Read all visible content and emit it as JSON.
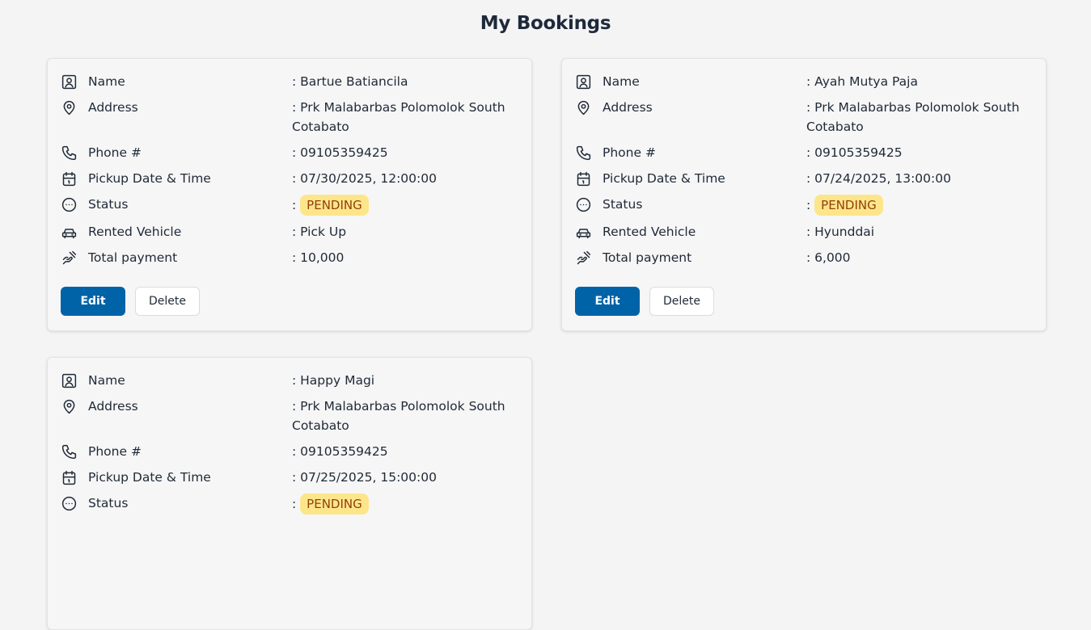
{
  "page_title": "My Bookings",
  "labels": {
    "name": "Name",
    "address": "Address",
    "phone": "Phone #",
    "pickup": "Pickup Date & Time",
    "status": "Status",
    "vehicle": "Rented Vehicle",
    "payment": "Total payment"
  },
  "buttons": {
    "edit": "Edit",
    "delete": "Delete"
  },
  "colors": {
    "primary": "#0063a8",
    "badge_bg": "#fde68a",
    "badge_text": "#92400e"
  },
  "bookings": [
    {
      "name": ": Bartue Batiancila",
      "address": ": Prk Malabarbas Polomolok South Cotabato",
      "phone": ": 09105359425",
      "pickup": ": 07/30/2025, 12:00:00",
      "status_prefix": ":",
      "status": "PENDING",
      "vehicle": ": Pick Up",
      "payment": ": 10,000"
    },
    {
      "name": ": Ayah Mutya Paja",
      "address": ": Prk Malabarbas Polomolok South Cotabato",
      "phone": ": 09105359425",
      "pickup": ": 07/24/2025, 13:00:00",
      "status_prefix": ":",
      "status": "PENDING",
      "vehicle": ": Hyunddai",
      "payment": ": 6,000"
    },
    {
      "name": ": Happy Magi",
      "address": ": Prk Malabarbas Polomolok South Cotabato",
      "phone": ": 09105359425",
      "pickup": ": 07/25/2025, 15:00:00",
      "status_prefix": ":",
      "status": "PENDING",
      "vehicle": "",
      "payment": ""
    }
  ]
}
